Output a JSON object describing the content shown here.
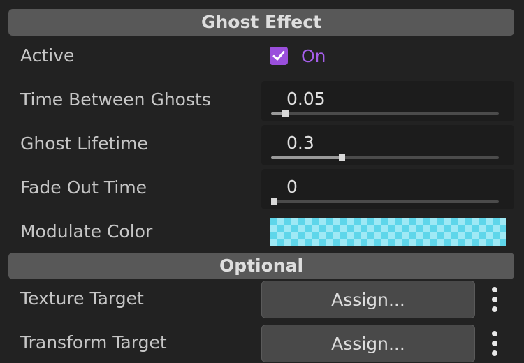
{
  "ghost_effect": {
    "header": "Ghost Effect",
    "active": {
      "label": "Active",
      "checked": true,
      "state_text": "On"
    },
    "time_between_ghosts": {
      "label": "Time Between Ghosts",
      "value": "0.05",
      "level": 0.06
    },
    "ghost_lifetime": {
      "label": "Ghost Lifetime",
      "value": "0.3",
      "level": 0.31
    },
    "fade_out_time": {
      "label": "Fade Out Time",
      "value": "0",
      "level": 0.0
    },
    "modulate_color": {
      "label": "Modulate Color",
      "color": "#5fd6ea",
      "alpha_checker": true
    }
  },
  "optional": {
    "header": "Optional",
    "texture_target": {
      "label": "Texture Target",
      "button": "Assign...",
      "menu_icon": "kebab-menu-icon"
    },
    "transform_target": {
      "label": "Transform Target",
      "button": "Assign...",
      "menu_icon": "kebab-menu-icon"
    }
  },
  "colors": {
    "accent": "#9a4fdc",
    "accent_text": "#a55eea",
    "header_bg": "#585858",
    "panel_bg": "#222222"
  }
}
